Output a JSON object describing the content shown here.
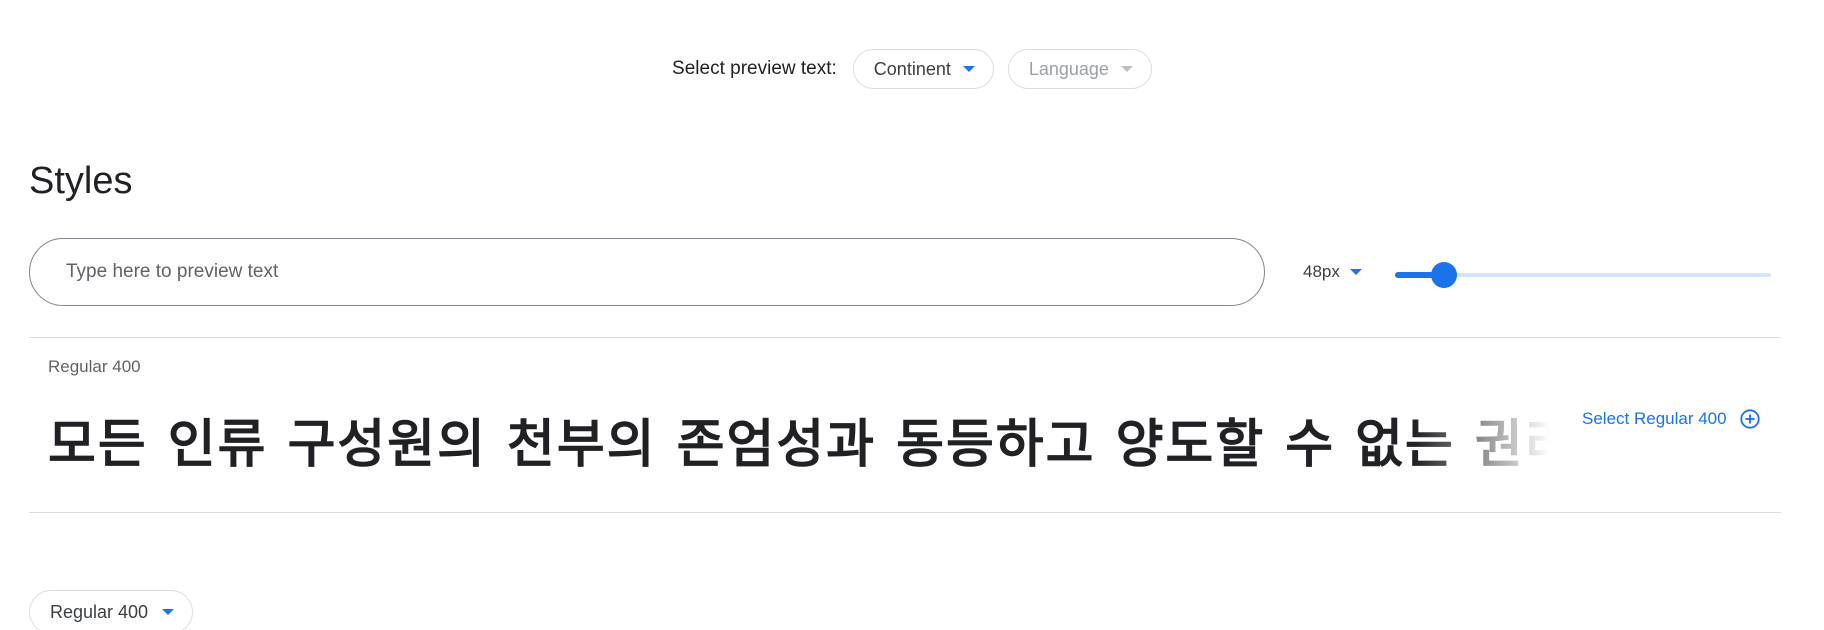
{
  "preview_selector": {
    "label": "Select preview text:",
    "continent": "Continent",
    "language": "Language"
  },
  "styles_section": {
    "title": "Styles",
    "input_placeholder": "Type here to preview text",
    "font_size": "48px",
    "slider_fraction": 0.13
  },
  "style_row": {
    "name": "Regular 400",
    "sample_text": "모든 인류 구성원의 천부의 존엄성과 동등하고 양도할 수 없는 권리를",
    "select_label": "Select Regular 400"
  },
  "bottom_filter": {
    "label": "Regular 400"
  },
  "colors": {
    "accent": "#1a73e8",
    "track": "#d2e3fc",
    "border": "#dadce0"
  },
  "icons": {
    "caret": "caret-down-icon",
    "add": "add-circle-icon"
  }
}
